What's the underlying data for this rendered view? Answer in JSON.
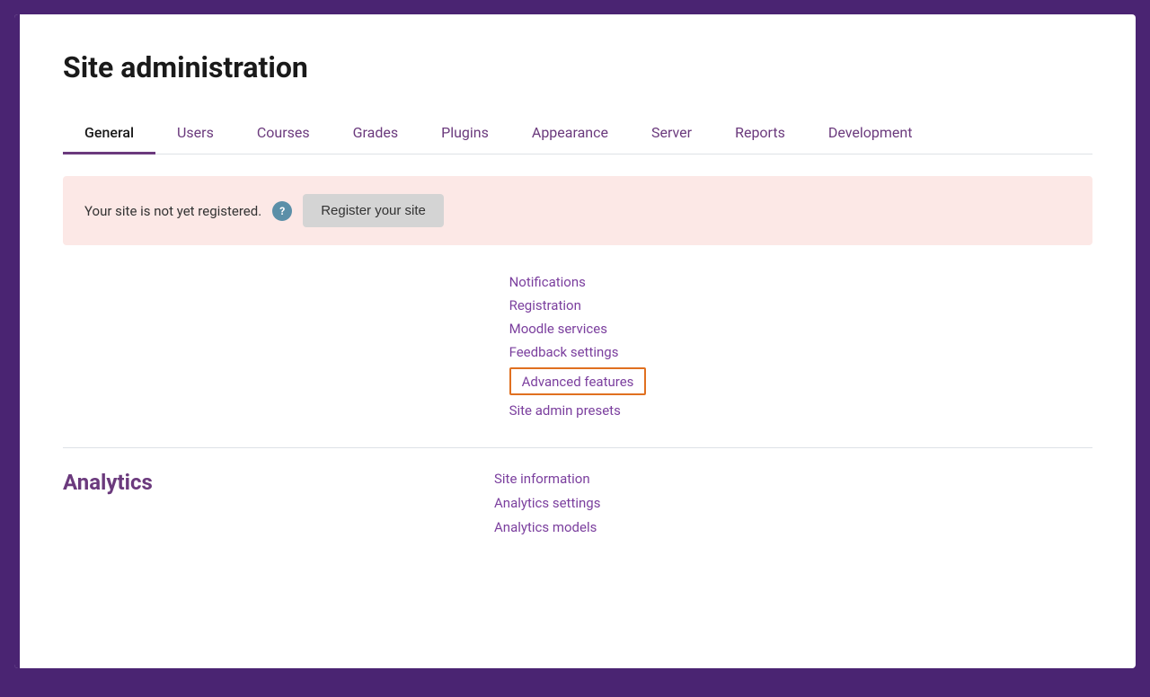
{
  "page": {
    "title": "Site administration"
  },
  "tabs": [
    {
      "id": "general",
      "label": "General",
      "active": true
    },
    {
      "id": "users",
      "label": "Users",
      "active": false
    },
    {
      "id": "courses",
      "label": "Courses",
      "active": false
    },
    {
      "id": "grades",
      "label": "Grades",
      "active": false
    },
    {
      "id": "plugins",
      "label": "Plugins",
      "active": false
    },
    {
      "id": "appearance",
      "label": "Appearance",
      "active": false
    },
    {
      "id": "server",
      "label": "Server",
      "active": false
    },
    {
      "id": "reports",
      "label": "Reports",
      "active": false
    },
    {
      "id": "development",
      "label": "Development",
      "active": false
    }
  ],
  "banner": {
    "text": "Your site is not yet registered.",
    "help_icon": "?",
    "button_label": "Register your site"
  },
  "general_links": [
    {
      "label": "Notifications",
      "highlighted": false
    },
    {
      "label": "Registration",
      "highlighted": false
    },
    {
      "label": "Moodle services",
      "highlighted": false
    },
    {
      "label": "Feedback settings",
      "highlighted": false
    },
    {
      "label": "Advanced features",
      "highlighted": true
    },
    {
      "label": "Site admin presets",
      "highlighted": false
    }
  ],
  "analytics_section": {
    "title": "Analytics",
    "links": [
      {
        "label": "Site information"
      },
      {
        "label": "Analytics settings"
      },
      {
        "label": "Analytics models"
      }
    ]
  }
}
